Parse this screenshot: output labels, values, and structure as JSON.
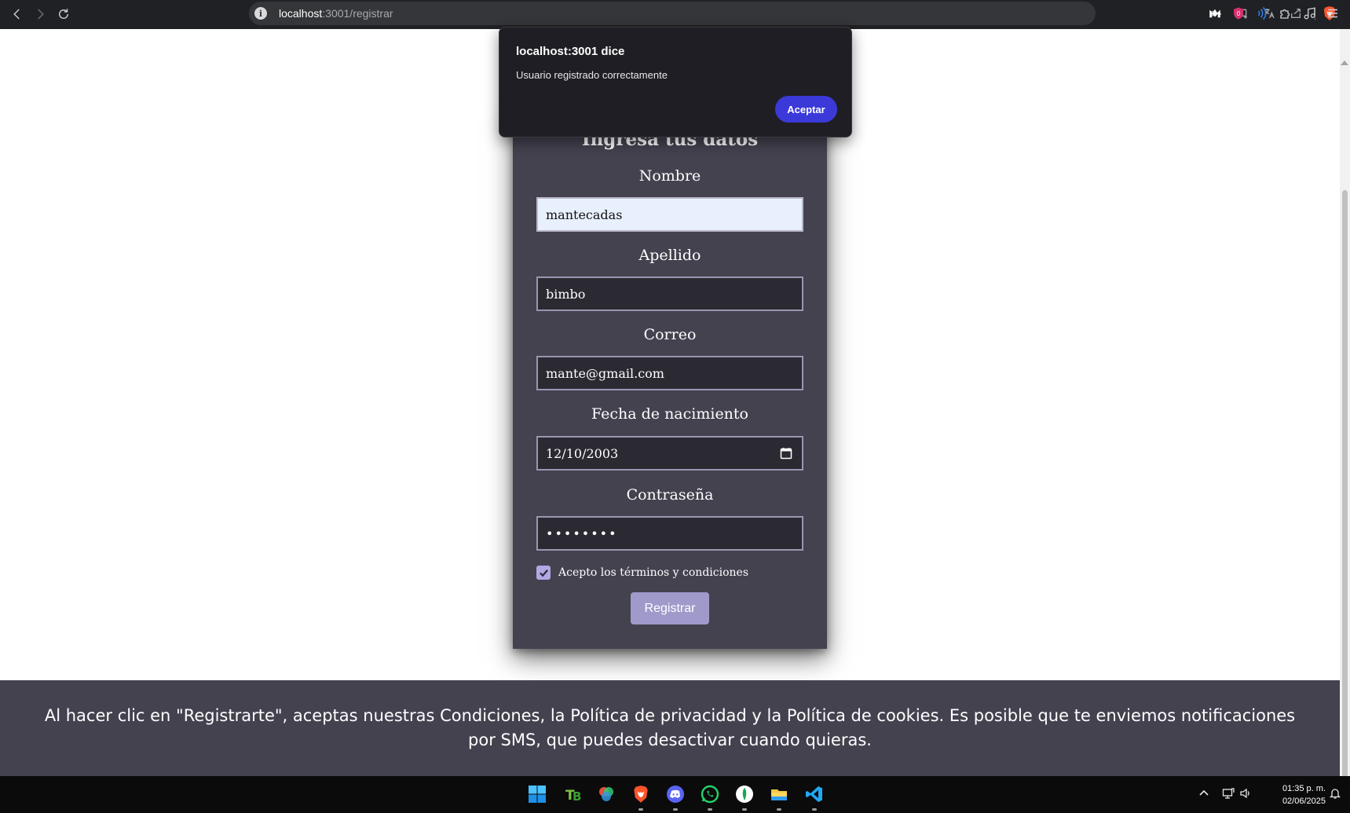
{
  "browser": {
    "url_host": "localhost",
    "url_rest": ":3001/registrar",
    "tab_info_icon": "info-icon"
  },
  "dialog": {
    "title": "localhost:3001 dice",
    "message": "Usuario registrado correctamente",
    "accept_label": "Aceptar"
  },
  "form": {
    "title": "Ingresa tus datos",
    "fields": {
      "nombre": {
        "label": "Nombre",
        "value": "mantecadas"
      },
      "apellido": {
        "label": "Apellido",
        "value": "bimbo"
      },
      "correo": {
        "label": "Correo",
        "value": "mante@gmail.com"
      },
      "fecha": {
        "label": "Fecha de nacimiento",
        "value": "12/10/2003"
      },
      "password": {
        "label": "Contraseña",
        "value": "••••••••"
      }
    },
    "terms_label": "Acepto los términos y condiciones",
    "terms_checked": true,
    "submit_label": "Registrar"
  },
  "footer": {
    "text": "Al hacer clic en \"Registrarte\", aceptas nuestras Condiciones, la Política de privacidad y la Política de cookies. Es posible que te enviemos notificaciones por SMS, que puedes desactivar cuando quieras."
  },
  "taskbar": {
    "time": "01:35 p. m.",
    "date": "02/06/2025"
  },
  "colors": {
    "card_bg": "#44424f",
    "dialog_button": "#3b3ad9",
    "submit_button": "#a09acb",
    "checkbox": "#b0a9e6"
  }
}
